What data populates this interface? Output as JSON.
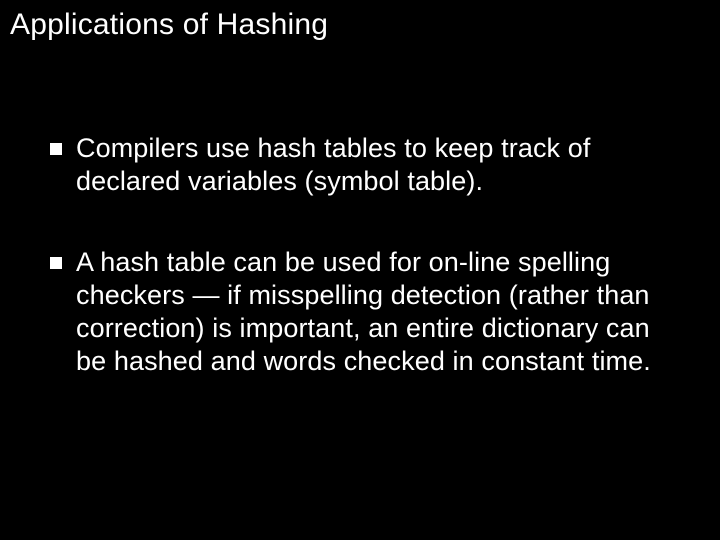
{
  "title": "Applications of Hashing",
  "bullets": [
    {
      "text": "Compilers use hash tables to keep track of declared variables (symbol table)."
    },
    {
      "text": "A hash table can be used for on-line spelling checkers — if misspelling detection (rather than correction) is important, an entire dictionary can be hashed and words checked in constant time."
    }
  ]
}
